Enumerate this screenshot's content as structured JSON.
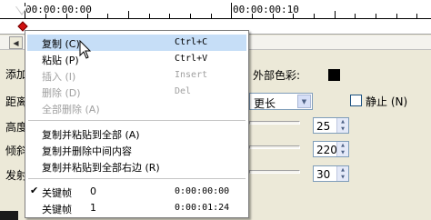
{
  "timeline": {
    "time_start": "00:00:00:00",
    "time_mid": "00:00:00:10"
  },
  "panel": {
    "add_label": "添加",
    "distance_label": "距离",
    "height_label": "高度",
    "tilt_label": "倾斜",
    "emit_label": "发射",
    "outer_color_label": "外部色彩:",
    "outer_color": "#000000",
    "length_select": "更长",
    "static_label": "静止 (N)",
    "static_checked": false,
    "values": [
      "25",
      "220",
      "30"
    ]
  },
  "context_menu": {
    "items": [
      {
        "label": "复制 (C)",
        "shortcut": "Ctrl+C",
        "state": "selected"
      },
      {
        "label": "粘贴 (P)",
        "shortcut": "Ctrl+V",
        "state": "normal"
      },
      {
        "label": "插入 (I)",
        "shortcut": "Insert",
        "state": "disabled"
      },
      {
        "label": "删除 (D)",
        "shortcut": "Del",
        "state": "disabled"
      },
      {
        "label": "全部删除 (A)",
        "shortcut": "",
        "state": "disabled"
      },
      {
        "label": "复制并粘贴到全部 (A)",
        "shortcut": "",
        "state": "normal"
      },
      {
        "label": "复制并删除中间内容",
        "shortcut": "",
        "state": "normal"
      },
      {
        "label": "复制并粘贴到全部右边 (R)",
        "shortcut": "",
        "state": "normal"
      }
    ],
    "keyframes": [
      {
        "name": "关键帧",
        "index": "0",
        "time": "0:00:00:00",
        "checked": true
      },
      {
        "name": "关键帧",
        "index": "1",
        "time": "0:00:01:24",
        "checked": false
      }
    ]
  },
  "colors": {
    "menu_highlight": "#c6def7",
    "keyframe_marker": "#d01010",
    "window_bg": "#ece9d8"
  }
}
